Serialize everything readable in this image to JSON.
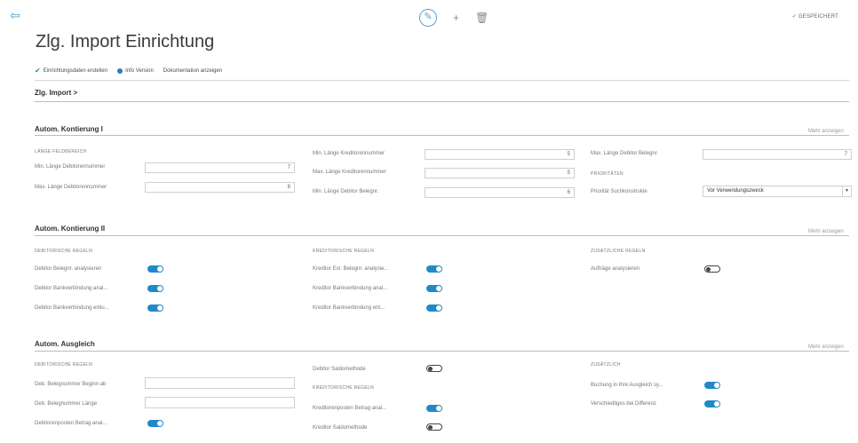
{
  "header": {
    "saved_label": "✓ GESPEICHERT",
    "title": "Zlg. Import Einrichtung"
  },
  "actions": [
    {
      "label": "Einrichtungsdaten erstellen",
      "icon": "checkmark-icon"
    },
    {
      "label": "Info Version",
      "icon": "info-icon"
    },
    {
      "label": "Dokumentation anzeigen",
      "icon": ""
    }
  ],
  "breadcrumb": "Zlg. Import >",
  "show_more": "Mehr anzeigen",
  "sections": {
    "s1": {
      "title": "Autom. Kontierung I",
      "group_length": "LÄNGE FELDBEREICH",
      "fields": [
        {
          "label": "Min. Länge Debitorennummer",
          "value": "7"
        },
        {
          "label": "Max. Länge Debitorennummer",
          "value": "8"
        },
        {
          "label": "Min. Länge Kreditorennummer",
          "value": "5"
        },
        {
          "label": "Max. Länge Kreditorennummer",
          "value": "5"
        },
        {
          "label": "Min. Länge Debitor Belegnr.",
          "value": "6"
        },
        {
          "label": "Max. Länge Debitor Belegnr.",
          "value": "7"
        }
      ],
      "group_prio": "PRIORITÄTEN",
      "prio_label": "Priorität Suchkonstrukte",
      "prio_value": "Vor Verwendungszweck"
    },
    "s2": {
      "title": "Autom. Kontierung II",
      "group_debit": "DEBITORISCHE REGELN",
      "debit": [
        {
          "label": "Debitor Belegnr. analysieren",
          "on": true
        },
        {
          "label": "Debitor Bankverbindung anal...",
          "on": true
        },
        {
          "label": "Debitor Bankverbindung einlu...",
          "on": true
        }
      ],
      "group_credit": "KREDITORISCHE REGELN",
      "credit": [
        {
          "label": "Kreditor Ext. Belegnr. analysie...",
          "on": true
        },
        {
          "label": "Kreditor Bankverbindung anal...",
          "on": true
        },
        {
          "label": "Kreditor Bankverbindung ent...",
          "on": true
        }
      ],
      "group_additional": "ZUSÄTZLICHE REGELN",
      "additional": [
        {
          "label": "Aufträge analysieren",
          "on": false
        }
      ]
    },
    "s3": {
      "title": "Autom. Ausgleich",
      "group_debit": "DEBITORISCHE REGELN",
      "debit_fields": [
        {
          "label": "Deb. Belegnummer Beginn ab",
          "value": ""
        },
        {
          "label": "Deb. Belegnummer Länge",
          "value": ""
        }
      ],
      "debit_toggle": {
        "label": "Debitorenposten Betrag anal...",
        "on": true
      },
      "mid_toggle": {
        "label": "Debitor Saldomethode",
        "on": false
      },
      "group_credit": "KREDITORISCHE REGELN",
      "credit": [
        {
          "label": "Kreditorenposten Betrag anal...",
          "on": true
        },
        {
          "label": "Kreditor Saldomethode",
          "on": false
        }
      ],
      "group_additional": "ZUSÄTZLICH",
      "additional": [
        {
          "label": "Buchung in Ihre Ausgleich sy...",
          "on": true
        },
        {
          "label": "Verschiedliges bei Differenz",
          "on": true
        }
      ]
    }
  },
  "colors": {
    "accent": "#1f8ac7",
    "check": "#2e9a46"
  }
}
